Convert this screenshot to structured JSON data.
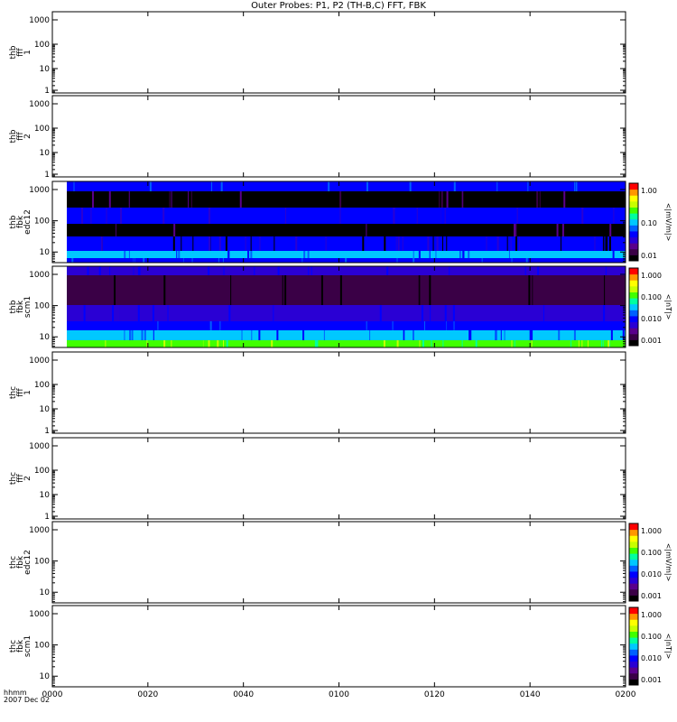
{
  "title": "Outer Probes: P1, P2 (TH-B,C) FFT, FBK",
  "x_axis": {
    "label_line1": "hhmm",
    "label_line2": "2007 Dec 02",
    "ticks": [
      "0000",
      "0020",
      "0040",
      "0100",
      "0120",
      "0140",
      "0200"
    ]
  },
  "colors": {
    "colormap": [
      "#000000",
      "#3a0046",
      "#5a008c",
      "#2a00d4",
      "#0000ff",
      "#0060ff",
      "#00c8ff",
      "#00ffa0",
      "#40ff00",
      "#c8ff00",
      "#ffff00",
      "#ff9600",
      "#ff0000"
    ]
  },
  "chart_data": [
    {
      "type": "heatmap",
      "name": "thb fff 1",
      "ylabel": [
        "thb",
        "fff",
        "1"
      ],
      "yscale": "log",
      "yticks": [
        "1000",
        "100",
        "10",
        "1"
      ],
      "has_data": false,
      "colorbar": null
    },
    {
      "type": "heatmap",
      "name": "thb fff 2",
      "ylabel": [
        "thb",
        "fff",
        "2"
      ],
      "yscale": "log",
      "yticks": [
        "1000",
        "100",
        "10",
        "1"
      ],
      "has_data": false,
      "colorbar": null
    },
    {
      "type": "heatmap",
      "name": "thb fbk edc12",
      "ylabel": [
        "thb",
        "fbk",
        "edc12"
      ],
      "yscale": "log",
      "yticks": [
        "1000",
        "100",
        "10"
      ],
      "has_data": true,
      "colorbar": {
        "ticks": [
          "1.00",
          "0.10",
          "0.01"
        ],
        "label": "<|mV/m|>"
      }
    },
    {
      "type": "heatmap",
      "name": "thb fbk scm1",
      "ylabel": [
        "thb",
        "fbk",
        "scm1"
      ],
      "yscale": "log",
      "yticks": [
        "1000",
        "100",
        "10"
      ],
      "has_data": true,
      "colorbar": {
        "ticks": [
          "1.000",
          "0.100",
          "0.010",
          "0.001"
        ],
        "label": "<|nT|>"
      }
    },
    {
      "type": "heatmap",
      "name": "thc fff 1",
      "ylabel": [
        "thc",
        "fff",
        "1"
      ],
      "yscale": "log",
      "yticks": [
        "1000",
        "100",
        "10",
        "1"
      ],
      "has_data": false,
      "colorbar": null
    },
    {
      "type": "heatmap",
      "name": "thc fff 2",
      "ylabel": [
        "thc",
        "fff",
        "2"
      ],
      "yscale": "log",
      "yticks": [
        "1000",
        "100",
        "10",
        "1"
      ],
      "has_data": false,
      "colorbar": null
    },
    {
      "type": "heatmap",
      "name": "thc fbk edc12",
      "ylabel": [
        "thc",
        "fbk",
        "edc12"
      ],
      "yscale": "log",
      "yticks": [
        "1000",
        "100",
        "10"
      ],
      "has_data": false,
      "colorbar": {
        "ticks": [
          "1.000",
          "0.100",
          "0.010",
          "0.001"
        ],
        "label": "<|mV/m|>"
      }
    },
    {
      "type": "heatmap",
      "name": "thc fbk scm1",
      "ylabel": [
        "thc",
        "fbk",
        "scm1"
      ],
      "yscale": "log",
      "yticks": [
        "1000",
        "100",
        "10"
      ],
      "has_data": false,
      "colorbar": {
        "ticks": [
          "1.000",
          "0.100",
          "0.010",
          "0.001"
        ],
        "label": "<|nT|>"
      }
    }
  ]
}
